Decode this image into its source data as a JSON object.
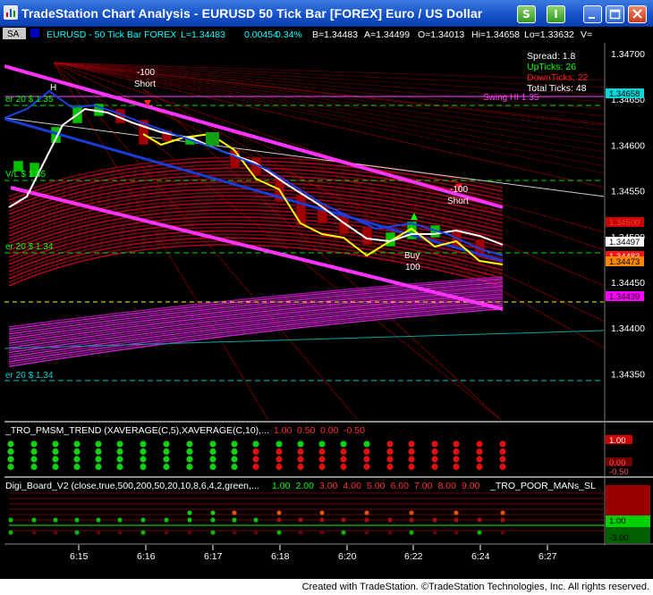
{
  "window": {
    "title": "TradeStation Chart Analysis - EURUSD 50 Tick Bar [FOREX] Euro / US Dollar",
    "buttons": [
      "S",
      "I"
    ]
  },
  "chart_header": {
    "sa_label": "SA",
    "symbol": "EURUSD - 50 Tick Bar  FOREX",
    "last": "L=1.34483",
    "change": "0.00454",
    "pct": "0.34%",
    "bid": "B=1.34483",
    "ask": "A=1.34499",
    "open": "O=1.34013",
    "hi": "Hi=1.34658",
    "lo": "Lo=1.33632",
    "v": "V="
  },
  "info_box": {
    "spread": "Spread: 1.8",
    "upticks": "UpTicks: 26",
    "downticks": "DownTicks: 22",
    "total": "Total Ticks: 48"
  },
  "price_axis": {
    "ticks": [
      "1.34700",
      "1.34650",
      "1.34600",
      "1.34550",
      "1.34500",
      "1.34450",
      "1.34400",
      "1.34350"
    ],
    "markers": [
      {
        "label": "1.34658",
        "color": "#00d8d8",
        "text": "#000000"
      },
      {
        "label": "1.34500",
        "color": "#c80000",
        "text": "#ff4040"
      },
      {
        "label": "1.34497",
        "color": "#ffffff",
        "text": "#000000"
      },
      {
        "label": "1.34483",
        "color": "#ff1010",
        "text": "#ffffff"
      },
      {
        "label": "1.34473",
        "color": "#ff8800",
        "text": "#000000"
      },
      {
        "label": "1.34439",
        "color": "#ff00ff",
        "text": "#000000"
      }
    ]
  },
  "time_axis": {
    "ticks": [
      "6:15",
      "6:16",
      "6:17",
      "6:18",
      "6:20",
      "6:22",
      "6:24",
      "6:27"
    ]
  },
  "level_labels": {
    "r1": "er 20 $ 1.35",
    "r2": "V/L $ 1.35",
    "r3": "er 20 $ 1.34",
    "r4": "er 20 $ 1.34",
    "hi": "H",
    "swing": "Swing HI 1.35"
  },
  "signals": {
    "short1": [
      "-100",
      "Short"
    ],
    "short2": [
      "-100",
      "Short"
    ],
    "buy": [
      "Buy",
      "100"
    ]
  },
  "panel2": {
    "name": "_TRO_PMSM_TREND (XAVERAGE(C,5),XAVERAGE(C,10),...",
    "values": [
      "1.00",
      "0.50",
      "0.00",
      "-0.50"
    ],
    "axis": [
      "1.00",
      "0.00",
      "-0.50"
    ]
  },
  "panel3": {
    "name": "Digi_Board_V2 (close,true,500,200,50,20,10,8,6,4,2,green,...",
    "values": [
      "1.00",
      "2.00",
      "3.00",
      "4.00",
      "5.00",
      "6.00",
      "7.00",
      "8.00",
      "9.00"
    ],
    "extra": "_TRO_POOR_MANs_SL",
    "axis": [
      "1.00",
      "-3.00"
    ]
  },
  "footer": {
    "text": "Created with TradeStation. ©TradeStation Technologies, Inc. All rights reserved."
  },
  "chart_data": {
    "type": "line",
    "title": "EURUSD - 50 Tick Bar  FOREX",
    "x": [
      "6:15",
      "6:16",
      "6:17",
      "6:18",
      "6:20",
      "6:22",
      "6:24",
      "6:27"
    ],
    "ylim": [
      1.3432,
      1.3473
    ],
    "series": [
      {
        "values": [
          1.3459,
          1.3462,
          1.346,
          1.3456,
          1.345,
          1.3449,
          1.345,
          1.3447
        ]
      },
      {
        "values": [
          1.3457,
          1.3463,
          1.3462,
          1.3458,
          1.3452,
          1.345,
          1.345,
          1.345
        ]
      }
    ]
  }
}
